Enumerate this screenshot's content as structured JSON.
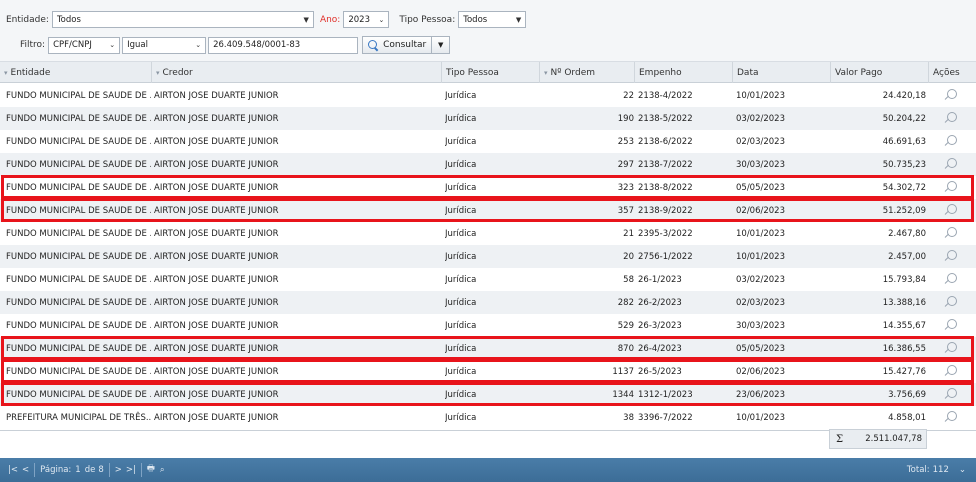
{
  "filters": {
    "entidade_label": "Entidade:",
    "entidade_value": "Todos",
    "ano_label": "Ano:",
    "ano_value": "2023",
    "tipo_label": "Tipo Pessoa:",
    "tipo_value": "Todos",
    "filtro_label": "Filtro:",
    "filtro_field": "CPF/CNPJ",
    "filtro_op": "Igual",
    "filtro_value": "26.409.548/0001-83",
    "consultar_label": "Consultar"
  },
  "table": {
    "headers": {
      "entidade": "Entidade",
      "credor": "Credor",
      "tipo": "Tipo Pessoa",
      "ordem": "Nº Ordem",
      "empenho": "Empenho",
      "data": "Data",
      "valor": "Valor Pago",
      "acoes": "Ações"
    },
    "rows": [
      {
        "entidade": "FUNDO MUNICIPAL DE SAUDE DE ...",
        "credor": "AIRTON JOSE DUARTE JUNIOR",
        "tipo": "Jurídica",
        "ordem": "22",
        "empenho": "2138-4/2022",
        "data": "10/01/2023",
        "valor": "24.420,18"
      },
      {
        "entidade": "FUNDO MUNICIPAL DE SAUDE DE ...",
        "credor": "AIRTON JOSE DUARTE JUNIOR",
        "tipo": "Jurídica",
        "ordem": "190",
        "empenho": "2138-5/2022",
        "data": "03/02/2023",
        "valor": "50.204,22"
      },
      {
        "entidade": "FUNDO MUNICIPAL DE SAUDE DE ...",
        "credor": "AIRTON JOSE DUARTE JUNIOR",
        "tipo": "Jurídica",
        "ordem": "253",
        "empenho": "2138-6/2022",
        "data": "02/03/2023",
        "valor": "46.691,63"
      },
      {
        "entidade": "FUNDO MUNICIPAL DE SAUDE DE ...",
        "credor": "AIRTON JOSE DUARTE JUNIOR",
        "tipo": "Jurídica",
        "ordem": "297",
        "empenho": "2138-7/2022",
        "data": "30/03/2023",
        "valor": "50.735,23"
      },
      {
        "entidade": "FUNDO MUNICIPAL DE SAUDE DE ...",
        "credor": "AIRTON JOSE DUARTE JUNIOR",
        "tipo": "Jurídica",
        "ordem": "323",
        "empenho": "2138-8/2022",
        "data": "05/05/2023",
        "valor": "54.302,72"
      },
      {
        "entidade": "FUNDO MUNICIPAL DE SAUDE DE ...",
        "credor": "AIRTON JOSE DUARTE JUNIOR",
        "tipo": "Jurídica",
        "ordem": "357",
        "empenho": "2138-9/2022",
        "data": "02/06/2023",
        "valor": "51.252,09"
      },
      {
        "entidade": "FUNDO MUNICIPAL DE SAUDE DE ...",
        "credor": "AIRTON JOSE DUARTE JUNIOR",
        "tipo": "Jurídica",
        "ordem": "21",
        "empenho": "2395-3/2022",
        "data": "10/01/2023",
        "valor": "2.467,80"
      },
      {
        "entidade": "FUNDO MUNICIPAL DE SAUDE DE ...",
        "credor": "AIRTON JOSE DUARTE JUNIOR",
        "tipo": "Jurídica",
        "ordem": "20",
        "empenho": "2756-1/2022",
        "data": "10/01/2023",
        "valor": "2.457,00"
      },
      {
        "entidade": "FUNDO MUNICIPAL DE SAUDE DE ...",
        "credor": "AIRTON JOSE DUARTE JUNIOR",
        "tipo": "Jurídica",
        "ordem": "58",
        "empenho": "26-1/2023",
        "data": "03/02/2023",
        "valor": "15.793,84"
      },
      {
        "entidade": "FUNDO MUNICIPAL DE SAUDE DE ...",
        "credor": "AIRTON JOSE DUARTE JUNIOR",
        "tipo": "Jurídica",
        "ordem": "282",
        "empenho": "26-2/2023",
        "data": "02/03/2023",
        "valor": "13.388,16"
      },
      {
        "entidade": "FUNDO MUNICIPAL DE SAUDE DE ...",
        "credor": "AIRTON JOSE DUARTE JUNIOR",
        "tipo": "Jurídica",
        "ordem": "529",
        "empenho": "26-3/2023",
        "data": "30/03/2023",
        "valor": "14.355,67"
      },
      {
        "entidade": "FUNDO MUNICIPAL DE SAUDE DE ...",
        "credor": "AIRTON JOSE DUARTE JUNIOR",
        "tipo": "Jurídica",
        "ordem": "870",
        "empenho": "26-4/2023",
        "data": "05/05/2023",
        "valor": "16.386,55"
      },
      {
        "entidade": "FUNDO MUNICIPAL DE SAUDE DE ...",
        "credor": "AIRTON JOSE DUARTE JUNIOR",
        "tipo": "Jurídica",
        "ordem": "1137",
        "empenho": "26-5/2023",
        "data": "02/06/2023",
        "valor": "15.427,76"
      },
      {
        "entidade": "FUNDO MUNICIPAL DE SAUDE DE ...",
        "credor": "AIRTON JOSE DUARTE JUNIOR",
        "tipo": "Jurídica",
        "ordem": "1344",
        "empenho": "1312-1/2023",
        "data": "23/06/2023",
        "valor": "3.756,69"
      },
      {
        "entidade": "PREFEITURA MUNICIPAL DE TRÊS...",
        "credor": "AIRTON JOSE DUARTE JUNIOR",
        "tipo": "Jurídica",
        "ordem": "38",
        "empenho": "3396-7/2022",
        "data": "10/01/2023",
        "valor": "4.858,01"
      }
    ],
    "highlighted_rows": [
      4,
      5,
      11,
      12,
      13
    ],
    "highlight_color": "#e8141b",
    "sum_symbol": "Σ",
    "sum_value": "2.511.047,78"
  },
  "footer": {
    "pagina_label": "Página:",
    "page": "1",
    "de_label": "de",
    "total_pages": "8",
    "total_label": "Total:",
    "total_count": "112"
  }
}
